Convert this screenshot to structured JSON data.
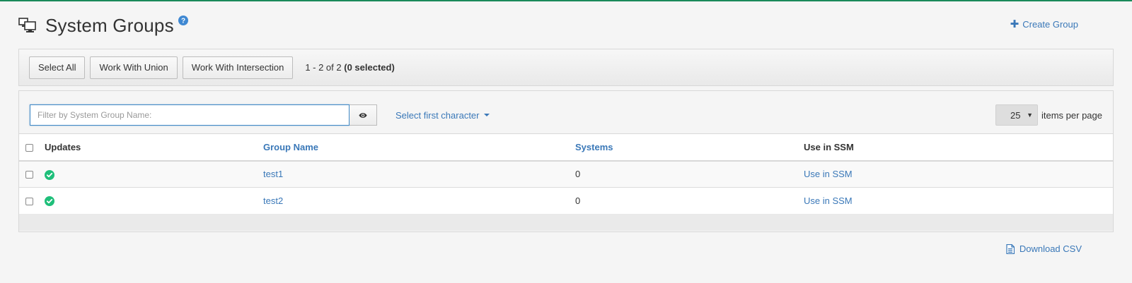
{
  "header": {
    "title": "System Groups",
    "icon": "system-groups-icon",
    "help_icon": "help-icon",
    "create_group_label": "Create Group"
  },
  "toolbar": {
    "buttons": {
      "select_all": "Select All",
      "work_with_union": "Work With Union",
      "work_with_intersection": "Work With Intersection"
    },
    "range": "1 - 2 of 2",
    "selected": "(0 selected)"
  },
  "filter": {
    "placeholder": "Filter by System Group Name:",
    "value": "",
    "first_character_label": "Select first character"
  },
  "pagination": {
    "per_page_value": "25",
    "per_page_label": "items per page"
  },
  "table": {
    "columns": {
      "updates": "Updates",
      "group_name": "Group Name",
      "systems": "Systems",
      "use_in_ssm": "Use in SSM"
    },
    "rows": [
      {
        "group_name": "test1",
        "systems": "0",
        "use_in_ssm": "Use in SSM",
        "updates_status": "ok"
      },
      {
        "group_name": "test2",
        "systems": "0",
        "use_in_ssm": "Use in SSM",
        "updates_status": "ok"
      }
    ]
  },
  "footer": {
    "download_csv_label": "Download CSV"
  },
  "colors": {
    "link": "#3a78b8",
    "status_ok": "#1fbf7a",
    "top_accent": "#1a8a5a"
  }
}
